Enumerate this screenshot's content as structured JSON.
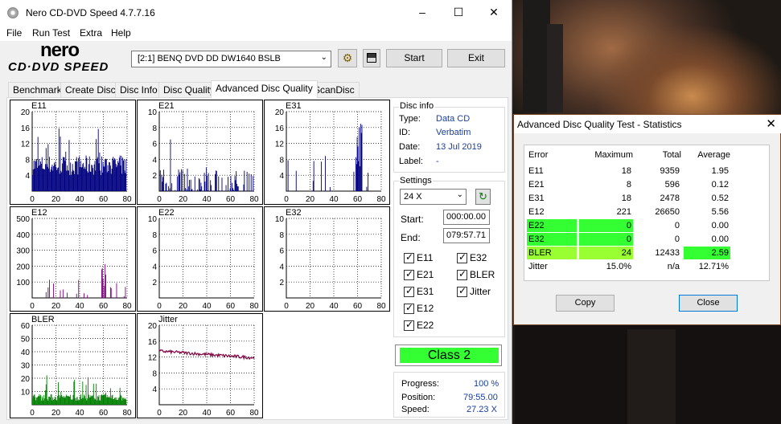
{
  "main_window": {
    "title": "Nero CD-DVD Speed 4.7.7.16",
    "menu": [
      "File",
      "Run Test",
      "Extra",
      "Help"
    ],
    "logo_top": "nero",
    "logo_bottom": "CD·DVD SPEED",
    "drive": "[2:1]   BENQ DVD DD DW1640 BSLB",
    "start_label": "Start",
    "exit_label": "Exit"
  },
  "tabs": [
    "Benchmark",
    "Create Disc",
    "Disc Info",
    "Disc Quality",
    "Advanced Disc Quality",
    "ScanDisc"
  ],
  "active_tab": "Advanced Disc Quality",
  "disc_info": {
    "title": "Disc info",
    "type_label": "Type:",
    "type": "Data CD",
    "id_label": "ID:",
    "id": "Verbatim",
    "date_label": "Date:",
    "date": "13 Jul 2019",
    "label_label": "Label:",
    "label": "-"
  },
  "settings": {
    "title": "Settings",
    "speed": "24 X",
    "start_label": "Start:",
    "start": "000:00.00",
    "end_label": "End:",
    "end": "079:57.71",
    "checks_left": [
      "E11",
      "E21",
      "E31",
      "E12",
      "E22"
    ],
    "checks_right": [
      "E32",
      "BLER",
      "Jitter"
    ]
  },
  "class": "Class 2",
  "progress": {
    "progress_label": "Progress:",
    "progress": "100 %",
    "position_label": "Position:",
    "position": "79:55.00",
    "speed_label": "Speed:",
    "speed": "27.23 X"
  },
  "statistics": {
    "title": "Advanced Disc Quality Test - Statistics",
    "headers": [
      "Error",
      "Maximum",
      "Total",
      "Average"
    ],
    "rows": [
      {
        "name": "E11",
        "max": "18",
        "total": "9359",
        "avg": "1.95"
      },
      {
        "name": "E21",
        "max": "8",
        "total": "596",
        "avg": "0.12"
      },
      {
        "name": "E31",
        "max": "18",
        "total": "2478",
        "avg": "0.52"
      },
      {
        "name": "E12",
        "max": "221",
        "total": "26650",
        "avg": "5.56"
      },
      {
        "name": "E22",
        "max": "0",
        "total": "0",
        "avg": "0.00"
      },
      {
        "name": "E32",
        "max": "0",
        "total": "0",
        "avg": "0.00"
      },
      {
        "name": "BLER",
        "max": "24",
        "total": "12433",
        "avg": "2.59"
      },
      {
        "name": "Jitter",
        "max": "15.0%",
        "total": "n/a",
        "avg": "12.71%"
      }
    ],
    "copy_label": "Copy",
    "close_label": "Close"
  },
  "colors": {
    "green_highlight": "#33ff33",
    "lime_highlight": "#99ff33",
    "navy_bars": "#000080",
    "purple_bars": "#800080",
    "green_bars": "#008000",
    "jitter_line": "#800040"
  },
  "chart_data": [
    {
      "name": "E11",
      "type": "bar",
      "xlim": [
        0,
        80
      ],
      "ylim": [
        0,
        20
      ],
      "yticks": [
        4,
        8,
        12,
        16,
        20
      ],
      "xticks": [
        0,
        20,
        40,
        60,
        80
      ],
      "color": "#000080",
      "max": 18,
      "avg": 1.95
    },
    {
      "name": "E21",
      "type": "bar",
      "xlim": [
        0,
        80
      ],
      "ylim": [
        0,
        10
      ],
      "yticks": [
        2,
        4,
        6,
        8,
        10
      ],
      "xticks": [
        0,
        20,
        40,
        60,
        80
      ],
      "color": "#000080",
      "max": 8,
      "avg": 0.12
    },
    {
      "name": "E31",
      "type": "bar",
      "xlim": [
        0,
        80
      ],
      "ylim": [
        0,
        20
      ],
      "yticks": [
        4,
        8,
        12,
        16,
        20
      ],
      "xticks": [
        0,
        20,
        40,
        60,
        80
      ],
      "color": "#000080",
      "max": 18,
      "avg": 0.52
    },
    {
      "name": "E12",
      "type": "bar",
      "xlim": [
        0,
        80
      ],
      "ylim": [
        0,
        500
      ],
      "yticks": [
        100,
        200,
        300,
        400,
        500
      ],
      "xticks": [
        0,
        20,
        40,
        60,
        80
      ],
      "color": "#800080",
      "max": 221,
      "avg": 5.56
    },
    {
      "name": "E22",
      "type": "bar",
      "xlim": [
        0,
        80
      ],
      "ylim": [
        0,
        10
      ],
      "yticks": [
        2,
        4,
        6,
        8,
        10
      ],
      "xticks": [
        0,
        20,
        40,
        60,
        80
      ],
      "color": "#000080",
      "max": 0,
      "avg": 0
    },
    {
      "name": "E32",
      "type": "bar",
      "xlim": [
        0,
        80
      ],
      "ylim": [
        0,
        10
      ],
      "yticks": [
        2,
        4,
        6,
        8,
        10
      ],
      "xticks": [
        0,
        20,
        40,
        60,
        80
      ],
      "color": "#000080",
      "max": 0,
      "avg": 0
    },
    {
      "name": "BLER",
      "type": "bar",
      "xlim": [
        0,
        80
      ],
      "ylim": [
        0,
        60
      ],
      "yticks": [
        10,
        20,
        30,
        40,
        50,
        60
      ],
      "xticks": [
        0,
        20,
        40,
        60,
        80
      ],
      "color": "#008000",
      "max": 24,
      "avg": 2.59
    },
    {
      "name": "Jitter",
      "type": "line",
      "xlim": [
        0,
        80
      ],
      "ylim": [
        0,
        20
      ],
      "yticks": [
        4,
        8,
        12,
        16,
        20
      ],
      "xticks": [
        0,
        20,
        40,
        60,
        80
      ],
      "color": "#800040",
      "start": 13.5,
      "end": 11.8
    }
  ]
}
